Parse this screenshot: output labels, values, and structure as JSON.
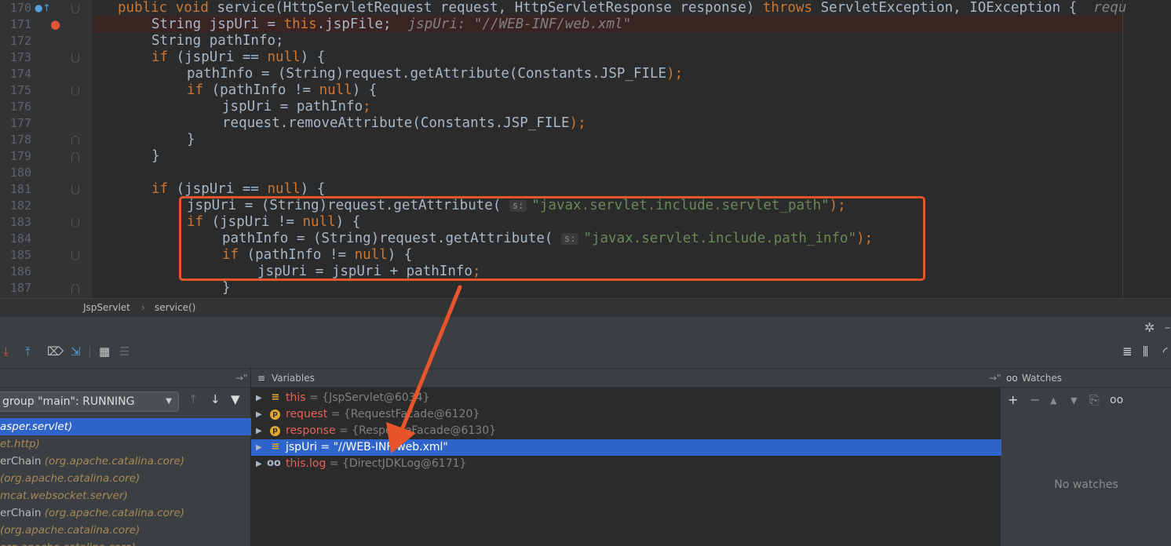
{
  "editor": {
    "lines": [
      {
        "num": "170",
        "html_segments": [
          [
            "kw",
            "public void "
          ],
          [
            "",
            "service(HttpServletRequest request, HttpServletResponse response) "
          ],
          [
            "kw",
            "throws "
          ],
          [
            "",
            "ServletException, IOException {  "
          ],
          [
            "cm",
            "requ"
          ]
        ]
      },
      {
        "num": "171",
        "html_segments": [
          [
            "",
            "String jspUri = "
          ],
          [
            "kw",
            "this"
          ],
          [
            "",
            ".jspFile;  "
          ],
          [
            "cm",
            "jspUri: \"//WEB-INF/web.xml\""
          ]
        ]
      },
      {
        "num": "172",
        "html_segments": [
          [
            "",
            "String pathInfo;"
          ]
        ]
      },
      {
        "num": "173",
        "html_segments": [
          [
            "kw",
            "if "
          ],
          [
            "",
            "(jspUri == "
          ],
          [
            "kw",
            "null"
          ],
          [
            "",
            ") {"
          ]
        ]
      },
      {
        "num": "174",
        "html_segments": [
          [
            "",
            "pathInfo = (String)request.getAttribute(Constants."
          ],
          [
            "",
            "JSP_FILE"
          ],
          [
            "kw",
            ");"
          ]
        ]
      },
      {
        "num": "175",
        "html_segments": [
          [
            "kw",
            "if "
          ],
          [
            "",
            "(pathInfo != "
          ],
          [
            "kw",
            "null"
          ],
          [
            "",
            ") {"
          ]
        ]
      },
      {
        "num": "176",
        "html_segments": [
          [
            "",
            "jspUri = pathInfo"
          ],
          [
            "kw",
            ";"
          ]
        ]
      },
      {
        "num": "177",
        "html_segments": [
          [
            "",
            "request.removeAttribute(Constants."
          ],
          [
            "",
            "JSP_FILE"
          ],
          [
            "kw",
            ");"
          ]
        ]
      },
      {
        "num": "178",
        "html_segments": [
          [
            "",
            "}"
          ]
        ]
      },
      {
        "num": "179",
        "html_segments": [
          [
            "",
            "}"
          ]
        ]
      },
      {
        "num": "180",
        "html_segments": []
      },
      {
        "num": "181",
        "html_segments": [
          [
            "kw",
            "if "
          ],
          [
            "",
            "(jspUri == "
          ],
          [
            "kw",
            "null"
          ],
          [
            "",
            ") {"
          ]
        ]
      },
      {
        "num": "182",
        "html_segments": [
          [
            "",
            "jspUri = (String)request.getAttribute( "
          ],
          [
            "hint",
            "s:"
          ],
          [
            "str",
            "\"javax.servlet.include.servlet_path\""
          ],
          [
            "kw",
            ");"
          ]
        ]
      },
      {
        "num": "183",
        "html_segments": [
          [
            "kw",
            "if "
          ],
          [
            "",
            "(jspUri != "
          ],
          [
            "kw",
            "null"
          ],
          [
            "",
            ") {"
          ]
        ]
      },
      {
        "num": "184",
        "html_segments": [
          [
            "",
            "pathInfo = (String)request.getAttribute( "
          ],
          [
            "hint",
            "s:"
          ],
          [
            "str",
            "\"javax.servlet.include.path_info\""
          ],
          [
            "kw",
            ");"
          ]
        ]
      },
      {
        "num": "185",
        "html_segments": [
          [
            "kw",
            "if "
          ],
          [
            "",
            "(pathInfo != "
          ],
          [
            "kw",
            "null"
          ],
          [
            "",
            ") {"
          ]
        ]
      },
      {
        "num": "186",
        "html_segments": [
          [
            "",
            "jspUri = jspUri + pathInfo"
          ],
          [
            "kw",
            ";"
          ]
        ]
      },
      {
        "num": "187",
        "html_segments": [
          [
            "",
            "}"
          ]
        ]
      }
    ],
    "breadcrumb": {
      "class_name": "JspServlet",
      "separator": "›",
      "method": "service()"
    }
  },
  "debugger": {
    "frames_header_pin": "→\"",
    "variables_label": "Variables",
    "watches_label": "Watches",
    "thread_selector": "group \"main\": RUNNING",
    "frames": [
      {
        "text": "asper.servlet)",
        "method": "",
        "selected": true
      },
      {
        "text": "et.http)",
        "method": "",
        "selected": false
      },
      {
        "text": "(org.apache.catalina.core)",
        "method": "erChain ",
        "selected": false
      },
      {
        "text": "(org.apache.catalina.core)",
        "method": "",
        "selected": false
      },
      {
        "text": "mcat.websocket.server)",
        "method": "",
        "selected": false
      },
      {
        "text": "(org.apache.catalina.core)",
        "method": "erChain ",
        "selected": false
      },
      {
        "text": "(org.apache.catalina.core)",
        "method": "",
        "selected": false
      },
      {
        "text": "org.apache.catalina.core)",
        "method": "",
        "selected": false
      }
    ],
    "variables": [
      {
        "icon": "field",
        "name": "this",
        "value": " = {JspServlet@6034}",
        "selected": false
      },
      {
        "icon": "param",
        "name": "request",
        "value": " = {RequestFacade@6120}",
        "selected": false
      },
      {
        "icon": "param",
        "name": "response",
        "value": " = {ResponseFacade@6130}",
        "selected": false
      },
      {
        "icon": "field",
        "name": "jspUri",
        "value": " = \"//WEB-INF/web.xml\"",
        "selected": true
      },
      {
        "icon": "glasses",
        "name": "this.log",
        "value": " = {DirectJDKLog@6171}",
        "selected": false
      }
    ],
    "no_watches": "No watches"
  },
  "colors": {
    "accent_highlight": "#e8542b",
    "selection": "#2f65ca"
  }
}
